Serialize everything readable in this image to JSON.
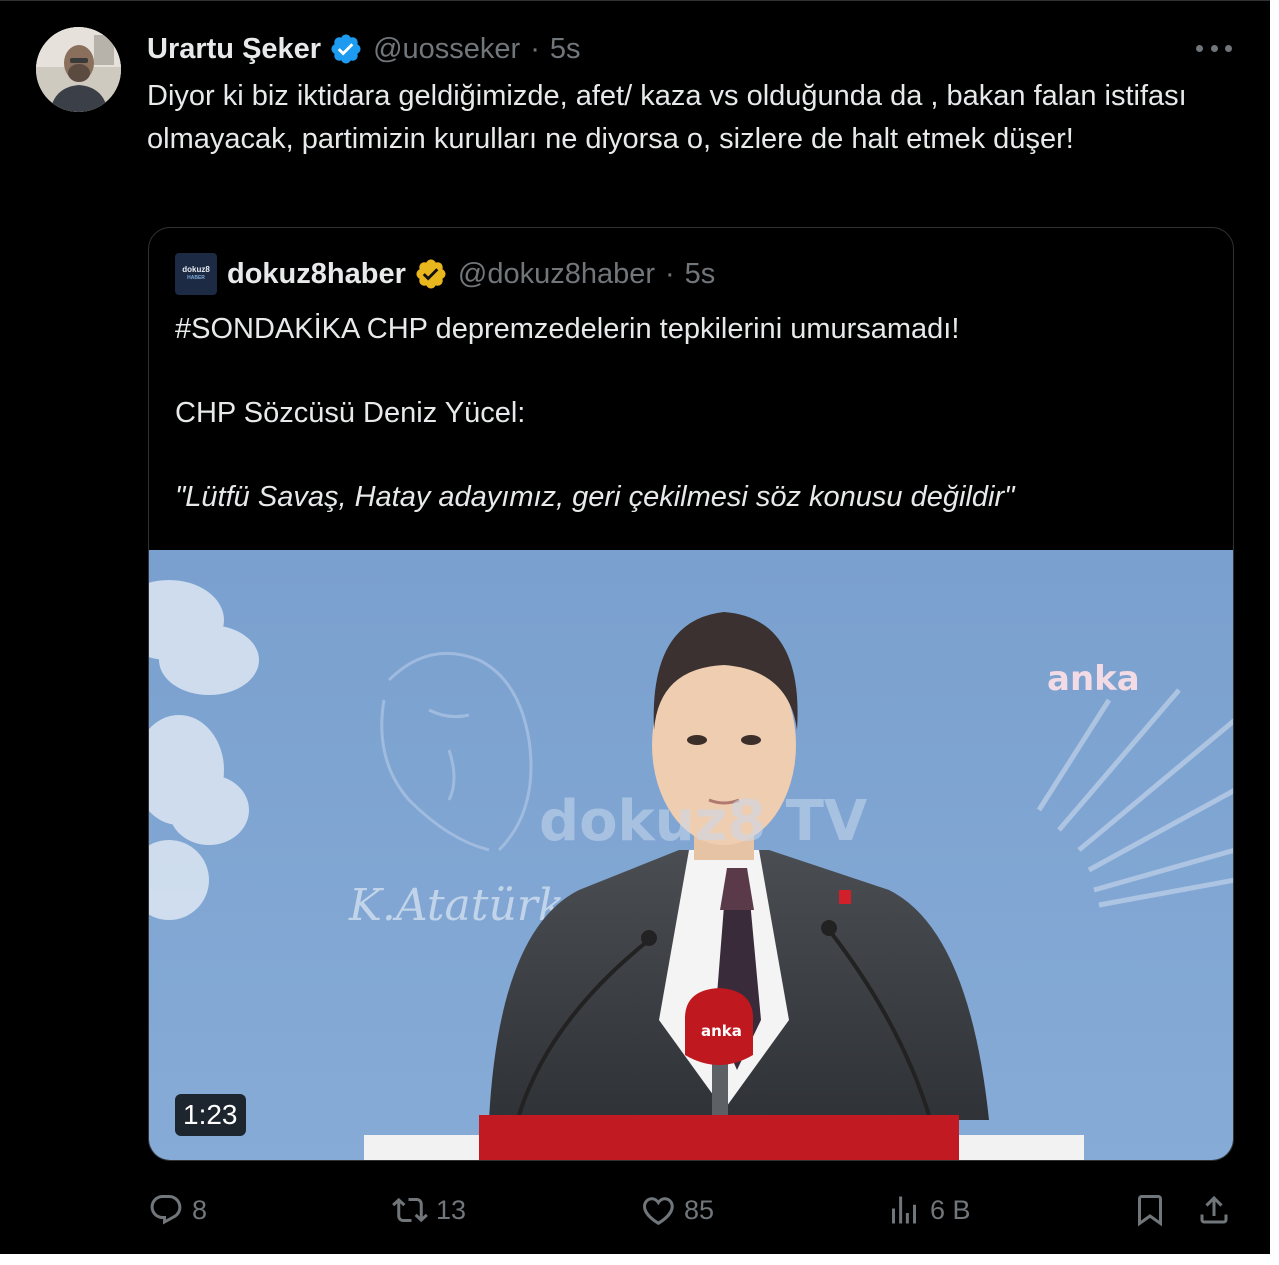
{
  "tweet": {
    "author_name": "Urartu Şeker",
    "handle": "@uosseker",
    "separator": "·",
    "time": "5s",
    "text": "Diyor ki biz iktidara geldiğimizde, afet/ kaza vs olduğunda da , bakan falan istifası olmayacak, partimizin kurulları ne diyorsa o, sizlere de halt etmek düşer!",
    "more_icon": "more-horizontal-icon",
    "verified_color": "#1d9bf0"
  },
  "quote": {
    "logo_text_top": "dokuz8",
    "logo_text_bottom": "HABER",
    "author_name": "dokuz8haber",
    "handle": "@dokuz8haber",
    "separator": "·",
    "time": "5s",
    "verified_color": "#e8b61d",
    "lines": [
      "#SONDAKİKA CHP depremzedelerin tepkilerini umursamadı!",
      "CHP Sözcüsü Deniz Yücel:",
      "\"Lütfü Savaş, Hatay adayımız, geri çekilmesi söz konusu değildir\""
    ],
    "media": {
      "duration": "1:23",
      "watermark_anka": "anka",
      "watermark_dokuz8": "dokuz8 TV",
      "signature": "K.Atatürk",
      "mic_label": "anka"
    }
  },
  "actions": {
    "reply_count": "8",
    "retweet_count": "13",
    "like_count": "85",
    "views_count": "6 B",
    "icons": [
      "reply-icon",
      "retweet-icon",
      "like-icon",
      "views-icon",
      "bookmark-icon",
      "share-icon"
    ]
  }
}
